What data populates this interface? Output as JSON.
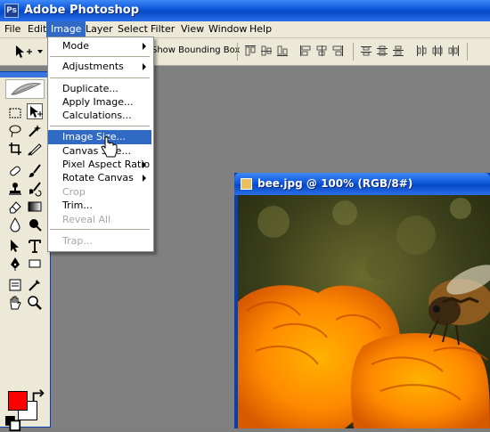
{
  "app": {
    "title": "Adobe Photoshop",
    "icon": "photoshop-app-icon"
  },
  "menubar": {
    "items": [
      {
        "id": "file",
        "label": "File"
      },
      {
        "id": "edit",
        "label": "Edit"
      },
      {
        "id": "image",
        "label": "Image",
        "active": true
      },
      {
        "id": "layer",
        "label": "Layer"
      },
      {
        "id": "select",
        "label": "Select"
      },
      {
        "id": "filter",
        "label": "Filter"
      },
      {
        "id": "view",
        "label": "View"
      },
      {
        "id": "window",
        "label": "Window"
      },
      {
        "id": "help",
        "label": "Help"
      }
    ]
  },
  "options_bar": {
    "show_bounding_box_label": "Show Bounding Box",
    "tool_preset_icon": "move-tool-icon"
  },
  "image_menu": {
    "items": [
      {
        "label": "Mode",
        "submenu": true,
        "enabled": true
      },
      {
        "label": "Adjustments",
        "submenu": true,
        "enabled": true
      },
      {
        "label": "Duplicate...",
        "submenu": false,
        "enabled": true
      },
      {
        "label": "Apply Image...",
        "submenu": false,
        "enabled": true
      },
      {
        "label": "Calculations...",
        "submenu": false,
        "enabled": true
      },
      {
        "label": "Image Size...",
        "submenu": false,
        "enabled": true,
        "highlighted": true
      },
      {
        "label": "Canvas Size...",
        "submenu": false,
        "enabled": true
      },
      {
        "label": "Pixel Aspect Ratio",
        "submenu": true,
        "enabled": true
      },
      {
        "label": "Rotate Canvas",
        "submenu": true,
        "enabled": true
      },
      {
        "label": "Crop",
        "submenu": false,
        "enabled": false
      },
      {
        "label": "Trim...",
        "submenu": false,
        "enabled": true
      },
      {
        "label": "Reveal All",
        "submenu": false,
        "enabled": false
      },
      {
        "label": "Trap...",
        "submenu": false,
        "enabled": false
      }
    ]
  },
  "document": {
    "title": "bee.jpg @ 100% (RGB/8#)"
  },
  "colors": {
    "foreground": "#ff0000",
    "background": "#ffffff",
    "menu_highlight": "#316ac5",
    "titlebar": "#0a53d8"
  }
}
